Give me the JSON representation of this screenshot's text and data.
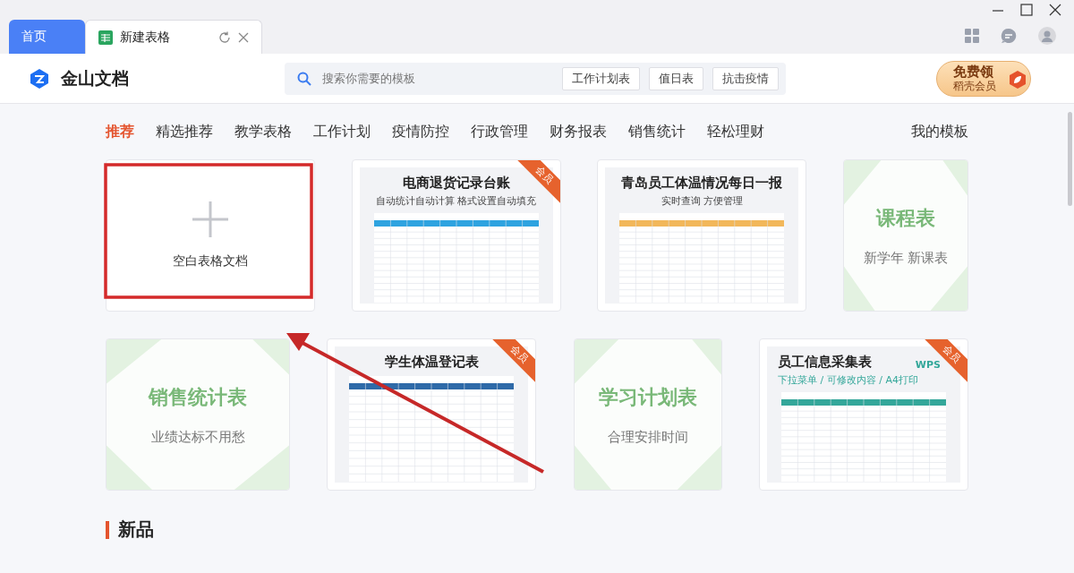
{
  "tabs": [
    {
      "label": "首页",
      "selected": false,
      "kind": "home"
    },
    {
      "label": "新建表格",
      "selected": true,
      "kind": "sheet"
    }
  ],
  "app": {
    "name": "金山文档"
  },
  "search": {
    "placeholder": "搜索你需要的模板",
    "tags": [
      "工作计划表",
      "值日表",
      "抗击疫情"
    ]
  },
  "promo": {
    "line1": "免费领",
    "line2": "稻壳会员"
  },
  "categories": [
    {
      "label": "推荐",
      "selected": true
    },
    {
      "label": "精选推荐",
      "selected": false
    },
    {
      "label": "教学表格",
      "selected": false
    },
    {
      "label": "工作计划",
      "selected": false
    },
    {
      "label": "疫情防控",
      "selected": false
    },
    {
      "label": "行政管理",
      "selected": false
    },
    {
      "label": "财务报表",
      "selected": false
    },
    {
      "label": "销售统计",
      "selected": false
    },
    {
      "label": "轻松理财",
      "selected": false
    }
  ],
  "my_templates": "我的模板",
  "rows": [
    [
      {
        "kind": "blank",
        "label": "空白表格文档"
      },
      {
        "kind": "sheet",
        "title": "电商退货记录台账",
        "subtitle": "自动统计自动计算 格式设置自动填充",
        "badge": "会员",
        "color": "#2ea3e0"
      },
      {
        "kind": "sheet",
        "title": "青岛员工体温情况每日一报",
        "subtitle": "实时查询 方便管理",
        "color": "#f2b75a"
      },
      {
        "kind": "text",
        "title": "课程表",
        "subtitle": "新学年 新课表"
      }
    ],
    [
      {
        "kind": "text",
        "title": "销售统计表",
        "subtitle": "业绩达标不用愁"
      },
      {
        "kind": "sheet",
        "title": "学生体温登记表",
        "badge": "会员",
        "color": "#2f6aa8"
      },
      {
        "kind": "text",
        "title": "学习计划表",
        "subtitle": "合理安排时间"
      },
      {
        "kind": "sheet",
        "title": "员工信息采集表",
        "subtitle": "下拉菜单 / 可修改内容 / A4打印",
        "brand": "WPS",
        "badge": "会员",
        "color": "#34a79a"
      }
    ]
  ],
  "section": {
    "title": "新品"
  }
}
